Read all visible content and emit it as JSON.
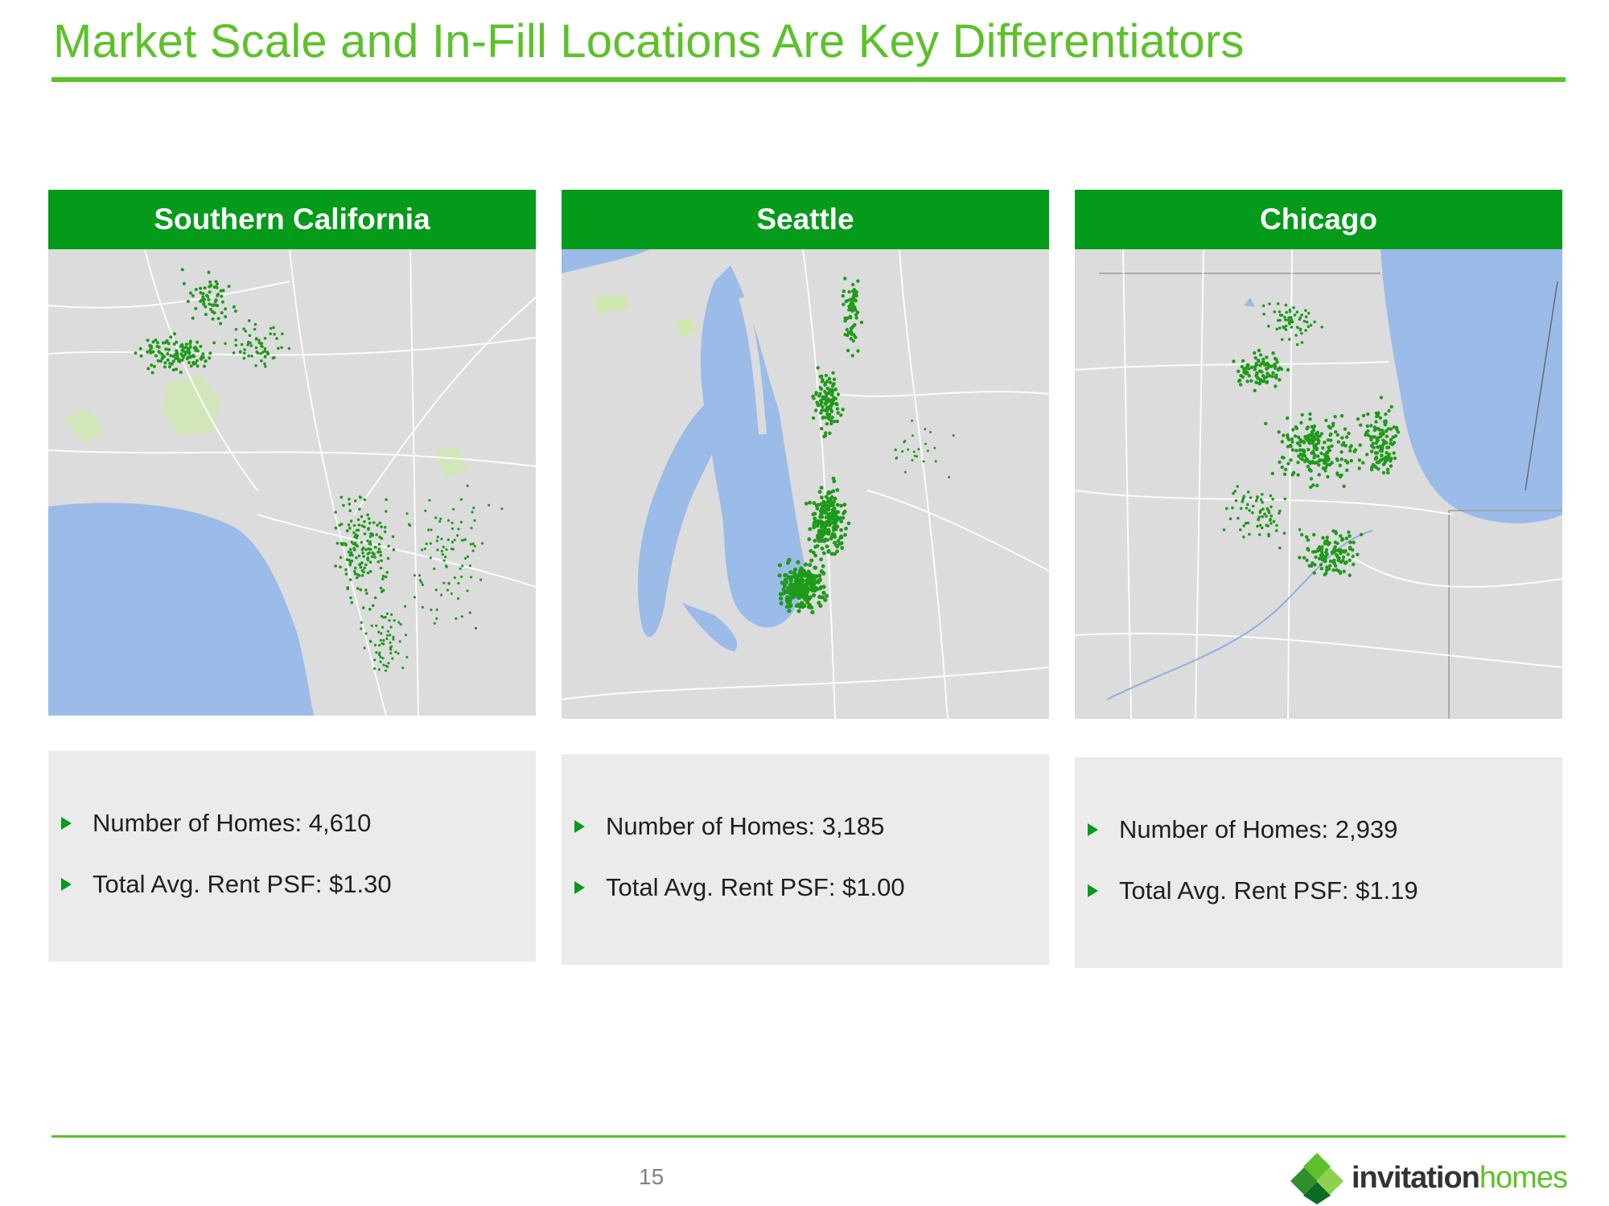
{
  "slide": {
    "title": "Market Scale and In-Fill Locations Are Key Differentiators",
    "page_number": "15"
  },
  "markets": [
    {
      "name": "Southern California",
      "homes_label": "Number of Homes: 4,610",
      "rent_label": "Total Avg. Rent PSF: $1.30"
    },
    {
      "name": "Seattle",
      "homes_label": "Number of Homes: 3,185",
      "rent_label": "Total Avg. Rent PSF: $1.00"
    },
    {
      "name": "Chicago",
      "homes_label": "Number of Homes: 2,939",
      "rent_label": "Total Avg. Rent PSF: $1.19"
    }
  ],
  "logo": {
    "word_a": "invitation",
    "word_b": "homes"
  },
  "colors": {
    "brand_green": "#5cc12a",
    "header_green": "#049a1a",
    "water": "#9bbbe8",
    "land": "#dcdcdc",
    "home_dot": "#1f9a1a"
  }
}
